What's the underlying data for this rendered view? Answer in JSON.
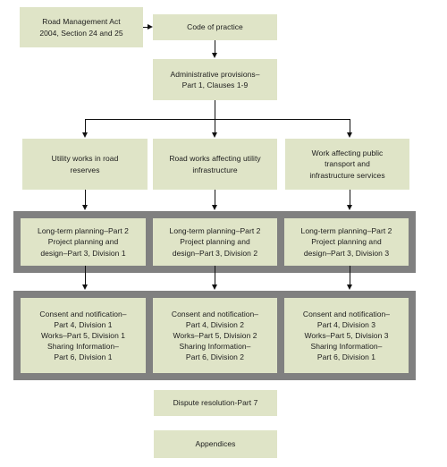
{
  "diagram": {
    "title": "Road Management Act Code of Practice structure flowchart",
    "colors": {
      "box_fill": "#dfe4c7",
      "band_fill": "#808080",
      "background": "#ffffff",
      "connector": "#111111",
      "text": "#1c1c1c"
    },
    "nodes": {
      "act": {
        "line1": "Road Management Act",
        "line2": "2004, Section 24 and 25"
      },
      "code_of_practice": {
        "line1": "Code of practice"
      },
      "administrative_provisions": {
        "line1": "Administrative provisions–",
        "line2": "Part 1, Clauses 1-9"
      },
      "columns": [
        {
          "header": {
            "line1": "Utility works in road",
            "line2": "reserves"
          },
          "planning": {
            "line1": "Long-term planning–Part 2",
            "line2": "Project planning and",
            "line3": "design–Part 3, Division 1"
          },
          "consent": {
            "line1": "Consent and notification–",
            "line2": "Part 4, Division 1",
            "line3": "Works–Part 5, Division 1",
            "line4": "Sharing Information–",
            "line5": "Part 6, Division 1"
          }
        },
        {
          "header": {
            "line1": "Road works affecting utility",
            "line2": "infrastructure"
          },
          "planning": {
            "line1": "Long-term planning–Part 2",
            "line2": "Project planning and",
            "line3": "design–Part 3, Division 2"
          },
          "consent": {
            "line1": "Consent and notification–",
            "line2": "Part 4, Division 2",
            "line3": "Works–Part 5, Division 2",
            "line4": "Sharing Information–",
            "line5": "Part 6, Division 2"
          }
        },
        {
          "header": {
            "line1": "Work affecting public",
            "line2": "transport and",
            "line3": "infrastructure services"
          },
          "planning": {
            "line1": "Long-term planning–Part 2",
            "line2": "Project planning and",
            "line3": "design–Part 3, Division 3"
          },
          "consent": {
            "line1": "Consent and notification–",
            "line2": "Part 4, Division 3",
            "line3": "Works–Part 5, Division 3",
            "line4": "Sharing Information–",
            "line5": "Part 6, Division 1"
          }
        }
      ],
      "dispute_resolution": {
        "line1": "Dispute resolution-Part 7"
      },
      "appendices": {
        "line1": "Appendices"
      }
    }
  }
}
